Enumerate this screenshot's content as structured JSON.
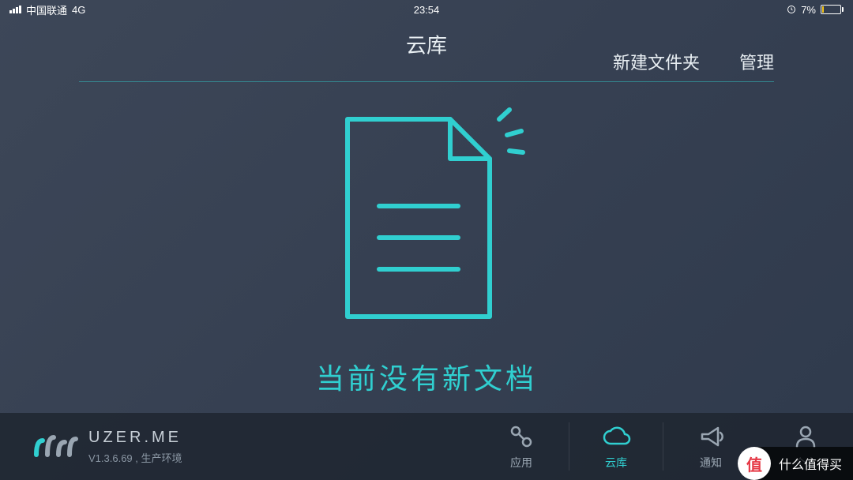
{
  "status_bar": {
    "carrier": "中国联通",
    "network": "4G",
    "time": "23:54",
    "battery_percent": "7%"
  },
  "header": {
    "title": "云库",
    "new_folder": "新建文件夹",
    "manage": "管理"
  },
  "content": {
    "empty_message": "当前没有新文档"
  },
  "brand": {
    "name": "UZER.ME",
    "version_line": "V1.3.6.69 , 生产环境"
  },
  "nav": {
    "apps": "应用",
    "cloud": "云库",
    "notify": "通知",
    "profile": "个人"
  },
  "watermark": {
    "badge": "值",
    "text": "什么值得买"
  },
  "colors": {
    "accent": "#30cfd0"
  }
}
